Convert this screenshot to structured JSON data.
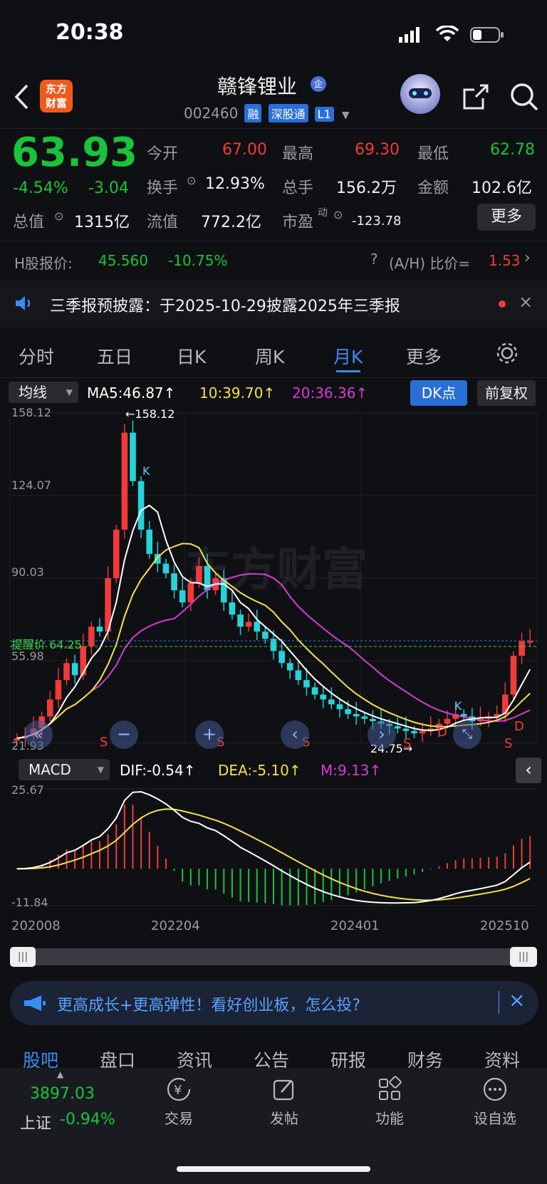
{
  "status_bar": {
    "time": "20:38"
  },
  "header": {
    "logo": "东方\n财富",
    "logo_line1": "东方",
    "logo_line2": "财富",
    "stock_name": "赣锋锂业",
    "badge": "企",
    "code": "002460",
    "tag1": "融",
    "tag2": "深股通",
    "tag3": "L1"
  },
  "quote": {
    "price": "63.93",
    "change_pct": "-4.54%",
    "change": "-3.04",
    "open_label": "今开",
    "open": "67.00",
    "high_label": "最高",
    "high": "69.30",
    "low_label": "最低",
    "low": "62.78",
    "turnover_label": "换手",
    "turnover": "12.93%",
    "volume_label": "总手",
    "volume": "156.2万",
    "amount_label": "金额",
    "amount": "102.6亿",
    "mcap_label": "总值",
    "mcap": "1315亿",
    "float_label": "流值",
    "float": "772.2亿",
    "pe_label": "市盈",
    "pe_sup": "动",
    "pe": "-123.78",
    "more_button": "更多"
  },
  "hshare": {
    "label": "H股报价:",
    "price": "45.560",
    "change": "-10.75%",
    "ratio_label": "(A/H) 比价=",
    "ratio": "1.53"
  },
  "notice": {
    "text": "三季报预披露：于2025-10-29披露2025年三季报"
  },
  "period_tabs": [
    "分时",
    "五日",
    "日K",
    "周K",
    "月K",
    "更多"
  ],
  "active_period": "月K",
  "ma_bar": {
    "selector": "均线",
    "ma5": "MA5:46.87↑",
    "ma10": "10:39.70↑",
    "ma20": "20:36.36↑",
    "dk_button": "DK点",
    "adjust_button": "前复权"
  },
  "chart_axis": {
    "y_top": "158.12",
    "y_2": "124.07",
    "y_3": "90.03",
    "y_4": "55.98",
    "y_bottom": "21.93",
    "high_marker": "←158.12",
    "low_marker": "24.75→",
    "remind_label": "提醒价 64.25",
    "watermark": "东方财富",
    "signal_k1": "K",
    "signal_s": "S",
    "signal_d": "D",
    "signal_k2": "K"
  },
  "macd_bar": {
    "selector": "MACD",
    "dif": "DIF:-0.54↑",
    "dea": "DEA:-5.10↑",
    "m": "M:9.13↑",
    "y_top": "25.67",
    "y_bottom": "-11.84"
  },
  "x_axis": [
    "202008",
    "202204",
    "202401",
    "202510"
  ],
  "ad_banner": {
    "text": "更高成长+更高弹性！看好创业板，怎么投?"
  },
  "bottom_tabs": [
    "股吧",
    "盘口",
    "资讯",
    "公告",
    "研报",
    "财务",
    "资料"
  ],
  "index": {
    "value": "3897.03",
    "name": "上证",
    "change": "-0.94%"
  },
  "nav": [
    "交易",
    "发帖",
    "功能",
    "设自选"
  ],
  "colors": {
    "up": "#f23a3a",
    "down": "#19c43a",
    "accent": "#2a6fd8",
    "ma5": "#ffffff",
    "ma10": "#f5e04a",
    "ma20": "#d63bd6",
    "candle_down": "#26d3d9"
  },
  "chart_data": {
    "type": "candlestick",
    "period": "monthly",
    "ylim": [
      21.93,
      158.12
    ],
    "max_price": 158.12,
    "min_price": 24.75,
    "remind_price": 64.25,
    "last_close": 63.93
  }
}
